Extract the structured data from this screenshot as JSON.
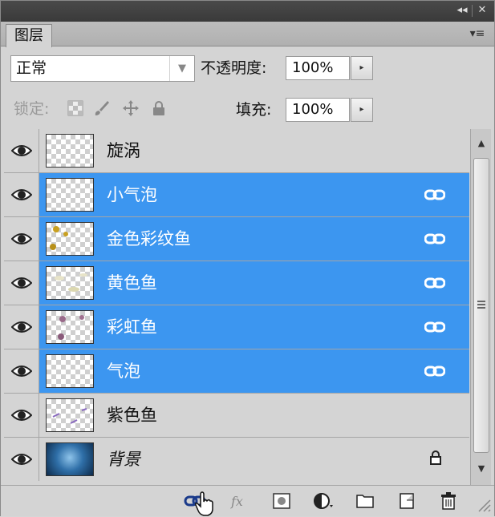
{
  "window": {
    "collapse_glyph": "◂◂",
    "close_glyph": "✕"
  },
  "panel": {
    "tab_label": "图层",
    "menu_glyph": "▾≡"
  },
  "blend": {
    "mode": "正常",
    "arrow": "▼"
  },
  "opacity": {
    "label": "不透明度:",
    "value": "100%",
    "spin": "▸"
  },
  "lock": {
    "label": "锁定:"
  },
  "fill": {
    "label": "填充:",
    "value": "100%",
    "spin": "▸"
  },
  "layers": [
    {
      "name": "旋涡",
      "selected": false,
      "linked": false,
      "locked": false
    },
    {
      "name": "小气泡",
      "selected": true,
      "linked": true,
      "locked": false
    },
    {
      "name": "金色彩纹鱼",
      "selected": true,
      "linked": true,
      "locked": false
    },
    {
      "name": "黄色鱼",
      "selected": true,
      "linked": true,
      "locked": false
    },
    {
      "name": "彩虹鱼",
      "selected": true,
      "linked": true,
      "locked": false
    },
    {
      "name": "气泡",
      "selected": true,
      "linked": true,
      "locked": false
    },
    {
      "name": "紫色鱼",
      "selected": false,
      "linked": false,
      "locked": false
    },
    {
      "name": "背景",
      "selected": false,
      "linked": false,
      "locked": true
    }
  ],
  "scrollbar": {
    "up": "▲",
    "down": "▼"
  },
  "colors": {
    "selection": "#3c96f0",
    "panel_bg": "#d4d4d4",
    "topbar": "#404040"
  }
}
